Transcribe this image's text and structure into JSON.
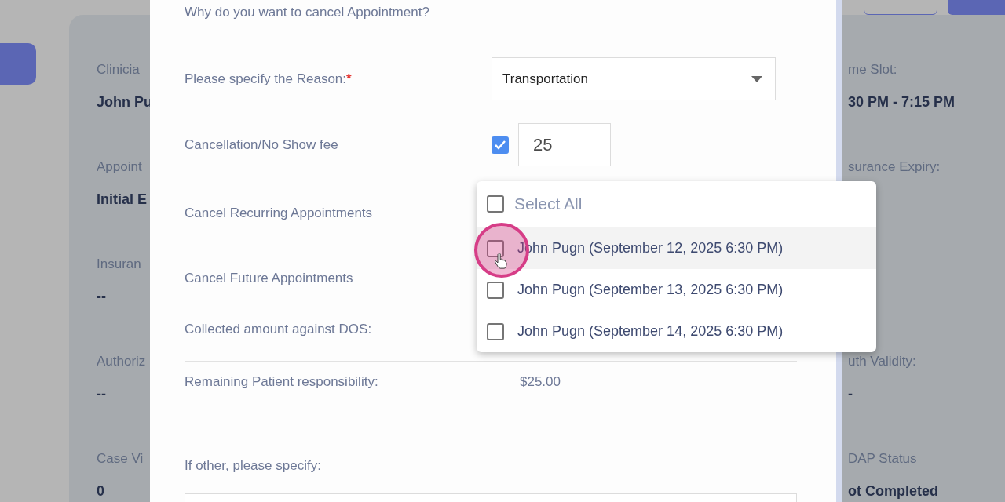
{
  "background": {
    "left_fields": [
      {
        "label": "Clinicia",
        "value": "John Pu"
      },
      {
        "label": "Appoint",
        "value": "Initial E"
      },
      {
        "label": "Insuran",
        "value": "--"
      },
      {
        "label": "Authoriz",
        "value": "--"
      },
      {
        "label": "Case Vi",
        "value": "0"
      }
    ],
    "right_fields": [
      {
        "label": "me Slot:",
        "value": "30 PM - 7:15 PM"
      },
      {
        "label": "surance Expiry:"
      },
      {
        "label": "uth Validity:",
        "value": "-"
      },
      {
        "label": "DAP Status",
        "value": "ot Completed"
      }
    ]
  },
  "modal": {
    "question": "Why do you want to cancel Appointment?",
    "reason": {
      "label": "Please specify the Reason:",
      "required_mark": "*",
      "value": "Transportation"
    },
    "fee": {
      "label": "Cancellation/No Show fee",
      "checked": true,
      "value": "25"
    },
    "recurring_label": "Cancel Recurring Appointments",
    "future_label": "Cancel Future Appointments",
    "collected_label": "Collected amount against DOS:",
    "remaining": {
      "label": "Remaining Patient responsibility:",
      "value": "$25.00"
    },
    "other_label": "If other, please specify:",
    "recurring_dropdown": {
      "select_all": {
        "label": "Select All",
        "checked": false
      },
      "items": [
        {
          "label": "John Pugn (September 12, 2025 6:30 PM)",
          "checked": false,
          "highlighted": true
        },
        {
          "label": "John Pugn (September 13, 2025 6:30 PM)",
          "checked": false,
          "highlighted": false
        },
        {
          "label": "John Pugn (September 14, 2025 6:30 PM)",
          "checked": false,
          "highlighted": false
        }
      ]
    }
  }
}
